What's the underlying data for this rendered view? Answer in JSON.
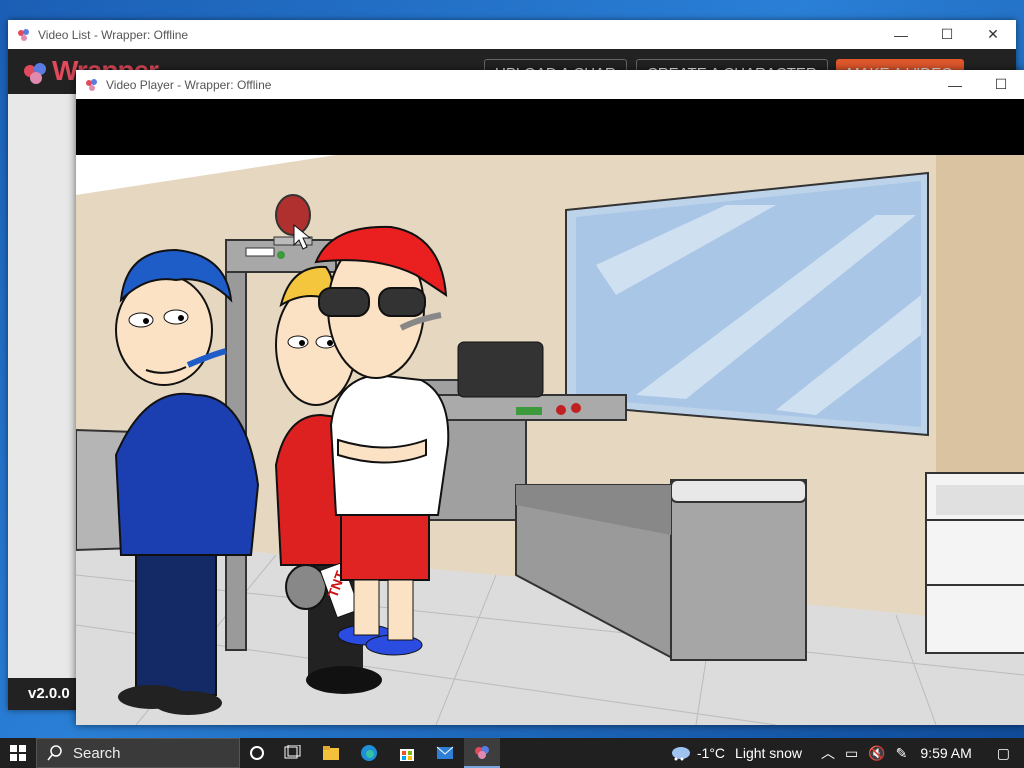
{
  "background_window": {
    "title": "Video List - Wrapper: Offline",
    "logo_text": "Wrapper",
    "nav": [
      "UPLOAD A CHAR",
      "CREATE A CHARACTER",
      "MAKE A VIDEO"
    ],
    "version": "v2.0.0"
  },
  "front_window": {
    "title": "Video Player - Wrapper: Offline"
  },
  "window_controls": {
    "minimize": "—",
    "maximize": "☐",
    "close": "✕"
  },
  "scene": {
    "sign_text": "TNT",
    "description_icons": [
      "boy-blue-hoodie",
      "boy-red-shirt",
      "boy-red-cap-sunglasses",
      "security-scanner",
      "x-ray-machine",
      "window",
      "shelf"
    ]
  },
  "taskbar": {
    "search_placeholder": "Search",
    "weather_temp": "-1°C",
    "weather_text": "Light snow",
    "time": "9:59 AM"
  },
  "colors": {
    "accent": "#e0582c",
    "taskbar": "#202020",
    "wall": "#e6d7c0"
  }
}
